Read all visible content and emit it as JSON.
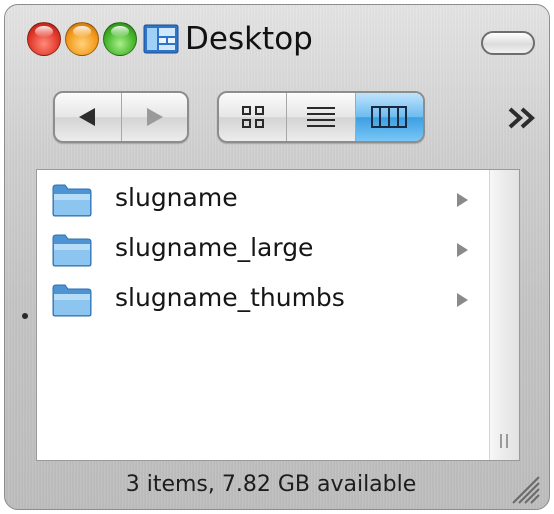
{
  "window": {
    "title": "Desktop",
    "title_icon": "folder-window-icon"
  },
  "title_bar": {
    "buttons": [
      "close-button",
      "minimize-button",
      "zoom-button"
    ],
    "toolbar_toggle": "toolbar-toggle-button"
  },
  "toolbar": {
    "back_icon": "back-arrow-icon",
    "forward_icon": "forward-arrow-icon",
    "view_modes": [
      {
        "name": "icon-view",
        "icon": "icon-grid-icon",
        "selected": false
      },
      {
        "name": "list-view",
        "icon": "list-lines-icon",
        "selected": false
      },
      {
        "name": "column-view",
        "icon": "columns-icon",
        "selected": true
      }
    ],
    "overflow_label": "»"
  },
  "files": [
    {
      "name": "slugname",
      "icon": "folder-icon",
      "has_children": true
    },
    {
      "name": "slugname_large",
      "icon": "folder-icon",
      "has_children": true
    },
    {
      "name": "slugname_thumbs",
      "icon": "folder-icon",
      "has_children": true
    }
  ],
  "status": {
    "text": "3 items, 7.82 GB available"
  },
  "colors": {
    "selected_segment": "#3d9fe2",
    "folder_blue": "#6ab4e8"
  }
}
